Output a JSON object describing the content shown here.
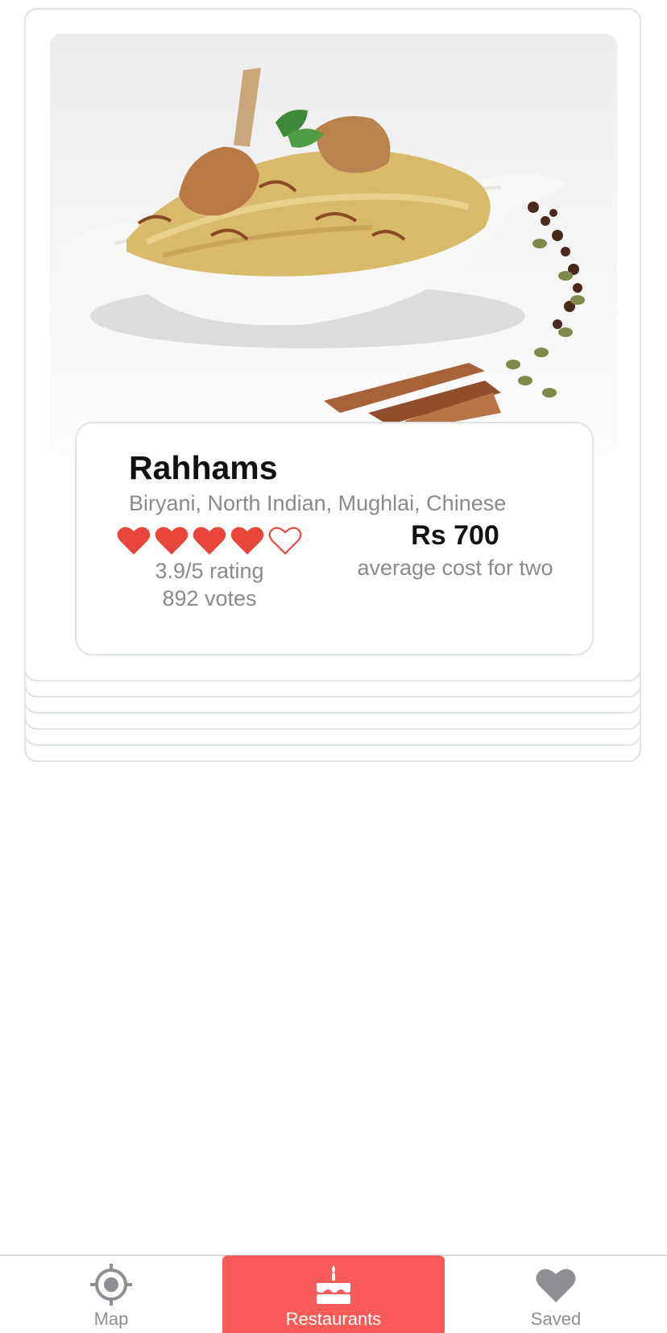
{
  "restaurant": {
    "name": "Rahhams",
    "cuisines": "Biryani, North Indian, Mughlai, Chinese",
    "photo_icon": "biryani-photo",
    "rating_value": 3.9,
    "rating_max": 5,
    "hearts_filled": 4,
    "rating_text": "3.9/5 rating",
    "votes_text": "892 votes",
    "price": "Rs 700",
    "price_caption": "average cost for two"
  },
  "tabs": [
    {
      "label": "Map",
      "icon": "target-icon",
      "selected": false
    },
    {
      "label": "Restaurants",
      "icon": "cake-icon",
      "selected": true
    },
    {
      "label": "Saved",
      "icon": "heart-icon",
      "selected": false
    }
  ],
  "colors": {
    "accent": "#fa5a5a",
    "heart": "#e8453c",
    "tab_inactive": "#8e8e93",
    "muted_text": "#8a8a8a",
    "card_border": "#dfe3ea"
  }
}
